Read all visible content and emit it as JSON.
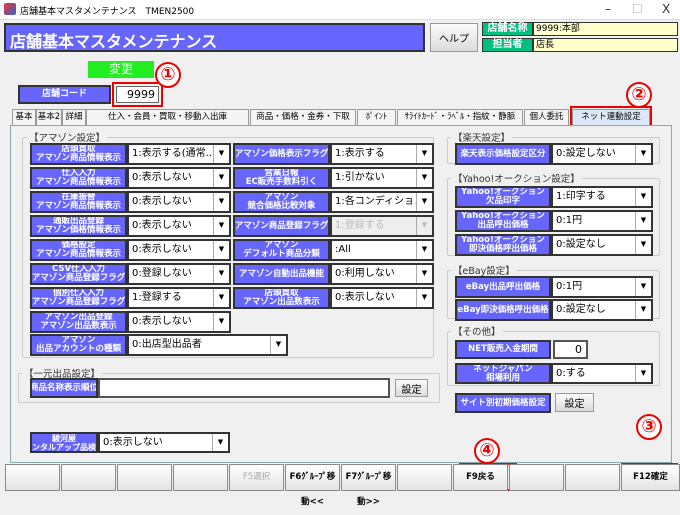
{
  "window": {
    "title": "店舗基本マスタメンテナンス　TMEN2500",
    "min": "–",
    "max": "☐",
    "close": "X"
  },
  "header": {
    "title": "店舗基本マスタメンテナンス",
    "help_label": "ヘルプ",
    "store_name_label": "店舗名称",
    "store_name_value": "9999:本部",
    "manager_label": "担当者",
    "manager_value": "店長"
  },
  "mode_badge": "変更",
  "store_code": {
    "label": "店舗コード",
    "value": "9999"
  },
  "tabs": [
    {
      "label": "基本"
    },
    {
      "label": "基本2"
    },
    {
      "label": "詳細"
    },
    {
      "label": "仕入・会員・買取・移動入出庫"
    },
    {
      "label": "商品・価格・金券・下取"
    },
    {
      "label": "ﾎﾟｲﾝﾄ"
    },
    {
      "label": "ｻﾗｲﾄｶｰﾄﾞ・ﾗﾍﾞﾙ・指紋・静脈"
    },
    {
      "label": "個人委託"
    },
    {
      "label": "ネット連動設定",
      "active": true
    }
  ],
  "amazon": {
    "title": "【アマゾン設定】",
    "fields": [
      {
        "label": "店頭買取\nアマゾン商品情報表示",
        "value": "1:表示する(通常..."
      },
      {
        "label": "アマゾン価格表示フラグ",
        "value": "1:表示する"
      },
      {
        "label": "仕入入力\nアマゾン商品情報表示",
        "value": "0:表示しない"
      },
      {
        "label": "営業日報\nEC販売手数料引く",
        "value": "1:引かない"
      },
      {
        "label": "在庫振替\nアマゾン商品情報表示",
        "value": "0:表示しない"
      },
      {
        "label": "アマゾン\n競合価格比較対象",
        "value": "1:各コンディションごと"
      },
      {
        "label": "通販出品登録\nアマゾン価格情報表示",
        "value": "0:表示しない"
      },
      {
        "label": "アマゾン商品登録フラグ",
        "value": "1:登録する",
        "disabled": true
      },
      {
        "label": "価格設定\nアマゾン商品情報表示",
        "value": "0:表示しない"
      },
      {
        "label": "アマゾン\nデフォルト商品分類",
        "value": ":All"
      },
      {
        "label": "CSV仕入入力\nアマゾン商品登録フラグ",
        "value": "0:登録しない"
      },
      {
        "label": "アマゾン自動出品機能",
        "value": "0:利用しない"
      },
      {
        "label": "個別仕入入力\nアマゾン商品登録フラグ",
        "value": "1:登録する"
      },
      {
        "label": "店頭買取\nアマゾン出品数表示",
        "value": "0:表示しない"
      },
      {
        "label": "アマゾン出品登録\nアマゾン出品数表示",
        "value": "0:表示しない"
      },
      {
        "label": "アマゾン\n出品アカウントの種類",
        "value": "0:出店型出品者"
      }
    ]
  },
  "ichigen": {
    "title": "【一元出品設定】",
    "label": "商品名称表示順位",
    "value": "",
    "button": "設定"
  },
  "surugaya": {
    "label": "駿河屋\nレンタルアップ品検索",
    "value": "0:表示しない"
  },
  "rakuten": {
    "title": "【楽天設定】",
    "fields": [
      {
        "label": "楽天表示価格設定区分",
        "value": "0:設定しない"
      }
    ]
  },
  "yahoo": {
    "title": "【Yahoo!オークション設定】",
    "fields": [
      {
        "label": "Yahoo!オークション\n欠品印字",
        "value": "1:印字する"
      },
      {
        "label": "Yahoo!オークション\n出品呼出価格",
        "value": "0:1円"
      },
      {
        "label": "Yahoo!オークション\n即決価格呼出価格",
        "value": "0:設定なし"
      }
    ]
  },
  "ebay": {
    "title": "【eBay設定】",
    "fields": [
      {
        "label": "eBay出品呼出価格",
        "value": "0:1円"
      },
      {
        "label": "eBay即決価格呼出価格",
        "value": "0:設定なし"
      }
    ]
  },
  "other": {
    "title": "【その他】",
    "net_label": "NET販売入金期間",
    "net_value": "0",
    "nj_label": "ネットジャパン\n相場利用",
    "nj_value": "0:する",
    "site_label": "サイト別初期価格設定",
    "site_button": "設定"
  },
  "fkeys": [
    "",
    "",
    "",
    "",
    "F5選択",
    "F6ｸﾞﾙｰﾌﾟ移動<<",
    "F7ｸﾞﾙｰﾌﾟ移動>>",
    "",
    "F9戻る",
    "",
    "",
    "F12確定"
  ],
  "annotations": [
    "①",
    "②",
    "③",
    "④"
  ],
  "colors": {
    "header": "#6666ff",
    "label": "#6666ff",
    "info_label": "#00c080",
    "mode": "#22ee22",
    "highlight": "#e00000"
  }
}
